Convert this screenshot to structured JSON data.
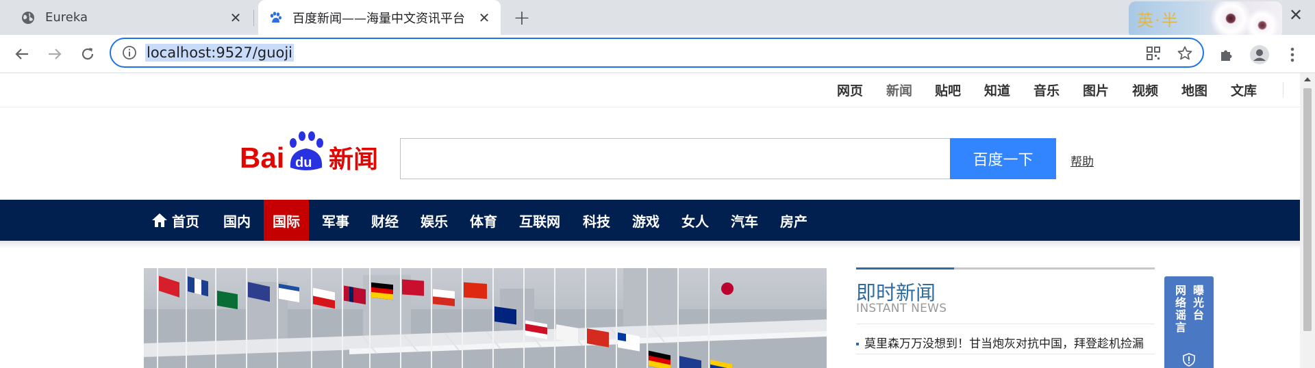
{
  "browser": {
    "tabs": [
      {
        "title": "Eureka",
        "icon": "globe-icon"
      },
      {
        "title": "百度新闻——海量中文资讯平台",
        "icon": "baidu-paw-icon"
      }
    ],
    "address": "localhost:9527/guoji",
    "decoration_text": "英·半"
  },
  "top_nav": [
    "网页",
    "新闻",
    "贴吧",
    "知道",
    "音乐",
    "图片",
    "视频",
    "地图",
    "文库"
  ],
  "search": {
    "button": "百度一下",
    "help": "帮助",
    "logo_text_bai": "Bai",
    "logo_text_du": "du",
    "logo_text_news": "新闻"
  },
  "categories": [
    "首页",
    "国内",
    "国际",
    "军事",
    "财经",
    "娱乐",
    "体育",
    "互联网",
    "科技",
    "游戏",
    "女人",
    "汽车",
    "房产"
  ],
  "active_category": "国际",
  "instant_news": {
    "title": "即时新闻",
    "subtitle": "INSTANT NEWS",
    "items": [
      "莫里森万万没想到！甘当炮灰对抗中国，拜登趁机捡漏"
    ]
  },
  "expose_panel": {
    "col1": "网络谣言",
    "col2": "曝光台"
  },
  "colors": {
    "nav_bg": "#01204f",
    "active_red": "#c50000",
    "search_blue": "#3385ff",
    "instant_blue": "#2e6da4",
    "expose_blue": "#4b78c2"
  }
}
